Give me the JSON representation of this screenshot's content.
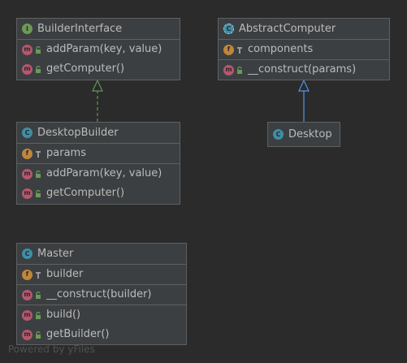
{
  "classes": {
    "builder_interface": {
      "name": "BuilderInterface",
      "kind_icon": "interface-icon",
      "methods": [
        "addParam(key, value)",
        "getComputer()"
      ]
    },
    "abstract_computer": {
      "name": "AbstractComputer",
      "kind_icon": "abstract-class-icon",
      "fields": [
        "components"
      ],
      "methods": [
        "__construct(params)"
      ]
    },
    "desktop_builder": {
      "name": "DesktopBuilder",
      "kind_icon": "class-icon",
      "fields": [
        "params"
      ],
      "methods": [
        "addParam(key, value)",
        "getComputer()"
      ]
    },
    "desktop": {
      "name": "Desktop",
      "kind_icon": "class-icon"
    },
    "master": {
      "name": "Master",
      "kind_icon": "class-icon",
      "fields": [
        "builder"
      ],
      "constructors": [
        "__construct(builder)"
      ],
      "methods": [
        "build()",
        "getBuilder()"
      ]
    }
  },
  "relations": [
    {
      "from": "DesktopBuilder",
      "to": "BuilderInterface",
      "type": "implements",
      "style": "dashed",
      "color": "#629755"
    },
    {
      "from": "Desktop",
      "to": "AbstractComputer",
      "type": "extends",
      "style": "solid",
      "color": "#5394ec"
    }
  ],
  "badge_letters": {
    "interface": "I",
    "class": "C",
    "field": "f",
    "method": "m"
  },
  "colors": {
    "background": "#2b2b2b",
    "node_fill": "#3c3f41",
    "node_border": "#5e6060",
    "text": "#bbbbbb",
    "method_badge": "#b5576e",
    "field_badge": "#c0863a",
    "class_badge": "#3f8ea5",
    "interface_badge": "#6a9a55",
    "public_icon": "#6a9a55"
  },
  "watermark": "Powered by yFiles"
}
